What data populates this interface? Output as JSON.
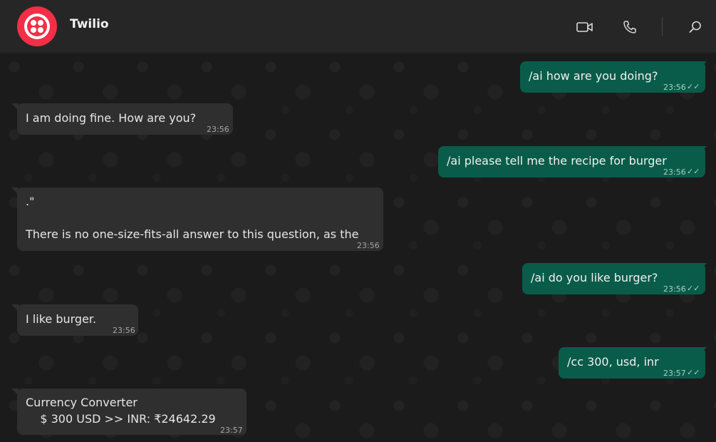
{
  "header": {
    "title": "Twilio",
    "icons": [
      "video-call-icon",
      "phone-icon",
      "search-icon"
    ]
  },
  "messages": [
    {
      "dir": "out",
      "text": "/ai how are you doing?",
      "time": "23:56"
    },
    {
      "dir": "in",
      "text": "I am doing fine. How are you?",
      "time": "23:56"
    },
    {
      "dir": "out",
      "text": "/ai please tell me the recipe for burger",
      "time": "23:56"
    },
    {
      "dir": "in",
      "text": ".\"",
      "text2": "There is no one-size-fits-all answer to this question, as the",
      "time": "23:56"
    },
    {
      "dir": "out",
      "text": "/ai do you like burger?",
      "time": "23:56"
    },
    {
      "dir": "in",
      "text": "I like burger.",
      "time": "23:56"
    },
    {
      "dir": "out",
      "text": "/cc 300, usd, inr",
      "time": "23:57"
    },
    {
      "dir": "in",
      "text": "Currency Converter",
      "text2": "    $ 300 USD >> INR: ₹24642.29",
      "time": "23:57"
    }
  ],
  "colors": {
    "brand": "#f22f46",
    "outgoing_bubble": "#0a5c4a",
    "incoming_bubble": "#2f2f2f",
    "background": "#1b1b1b"
  }
}
